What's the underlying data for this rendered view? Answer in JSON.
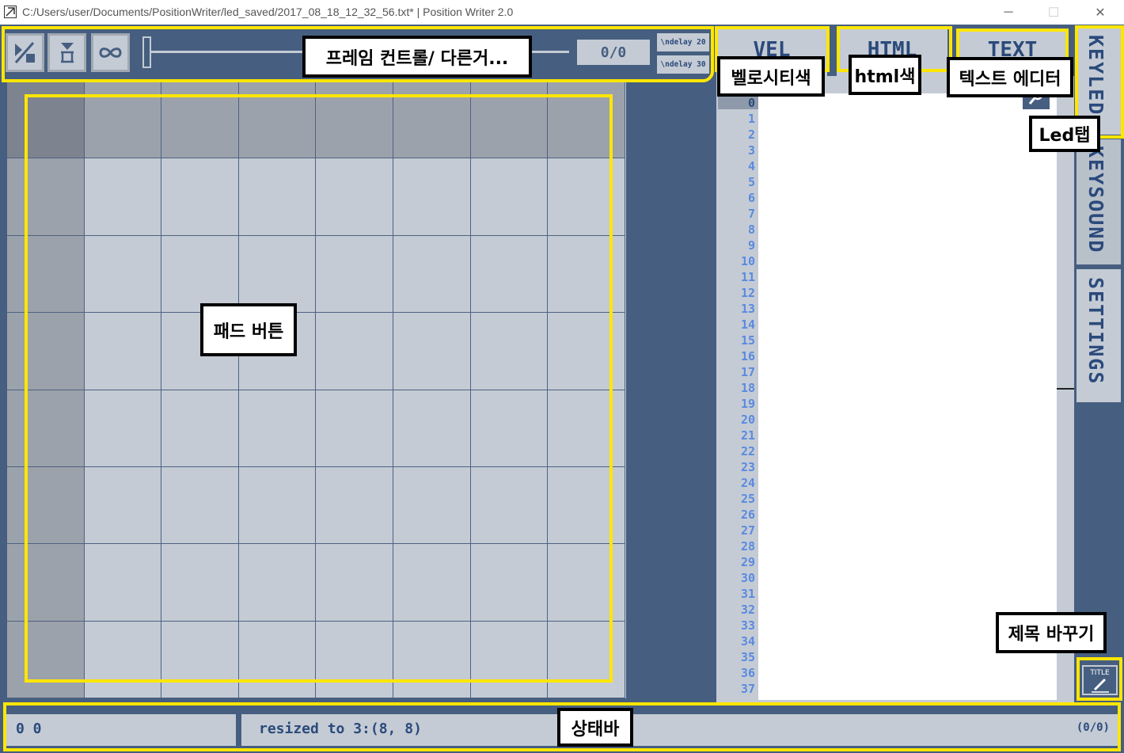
{
  "window": {
    "title": "C:/Users/user/Documents/PositionWriter/led_saved/2017_08_18_12_32_56.txt* | Position Writer 2.0",
    "minimize": "─",
    "maximize": "☐",
    "close": "✕"
  },
  "toolbar": {
    "buttons": [
      "toggle-icon",
      "frame-marker-icon",
      "loop-icon"
    ],
    "frame_counter": "0/0",
    "delay_buttons": [
      "\\ndelay 20",
      "\\ndelay 30"
    ]
  },
  "pad_grid": {
    "rows": 8,
    "cols": 8
  },
  "tabs": {
    "vel": "VEL",
    "html": "HTML",
    "text": "TEXT"
  },
  "editor": {
    "line_numbers": [
      "0",
      "1",
      "2",
      "3",
      "4",
      "5",
      "6",
      "7",
      "8",
      "9",
      "10",
      "11",
      "12",
      "13",
      "14",
      "15",
      "16",
      "17",
      "18",
      "19",
      "20",
      "21",
      "22",
      "23",
      "24",
      "25",
      "26",
      "27",
      "28",
      "29",
      "30",
      "31",
      "32",
      "33",
      "34",
      "35",
      "36",
      "37"
    ],
    "current_line": "0"
  },
  "side_tabs": {
    "keyled": "KEYLED",
    "keysound": "KEYSOUND",
    "settings": "SETTINGS"
  },
  "title_button": "TITLE",
  "status": {
    "coords": "0 0",
    "message": "resized to 3:(8, 8)",
    "count": "(0/0)"
  },
  "annotations": {
    "frame_control": "프레임 컨트롤/ 다른거...",
    "velocity_color": "벨로시티색",
    "html_color": "html색",
    "text_editor": "텍스트 에디터",
    "led_tab": "Led탭",
    "pad_buttons": "패드 버튼",
    "change_title": "제목 바꾸기",
    "status_bar": "상태바"
  },
  "colors": {
    "background": "#465e80",
    "panel": "#c4cbd4",
    "accent_text": "#2b4a7c",
    "line_numbers": "#5a8ae0",
    "annotation_outline": "#ffe600"
  }
}
